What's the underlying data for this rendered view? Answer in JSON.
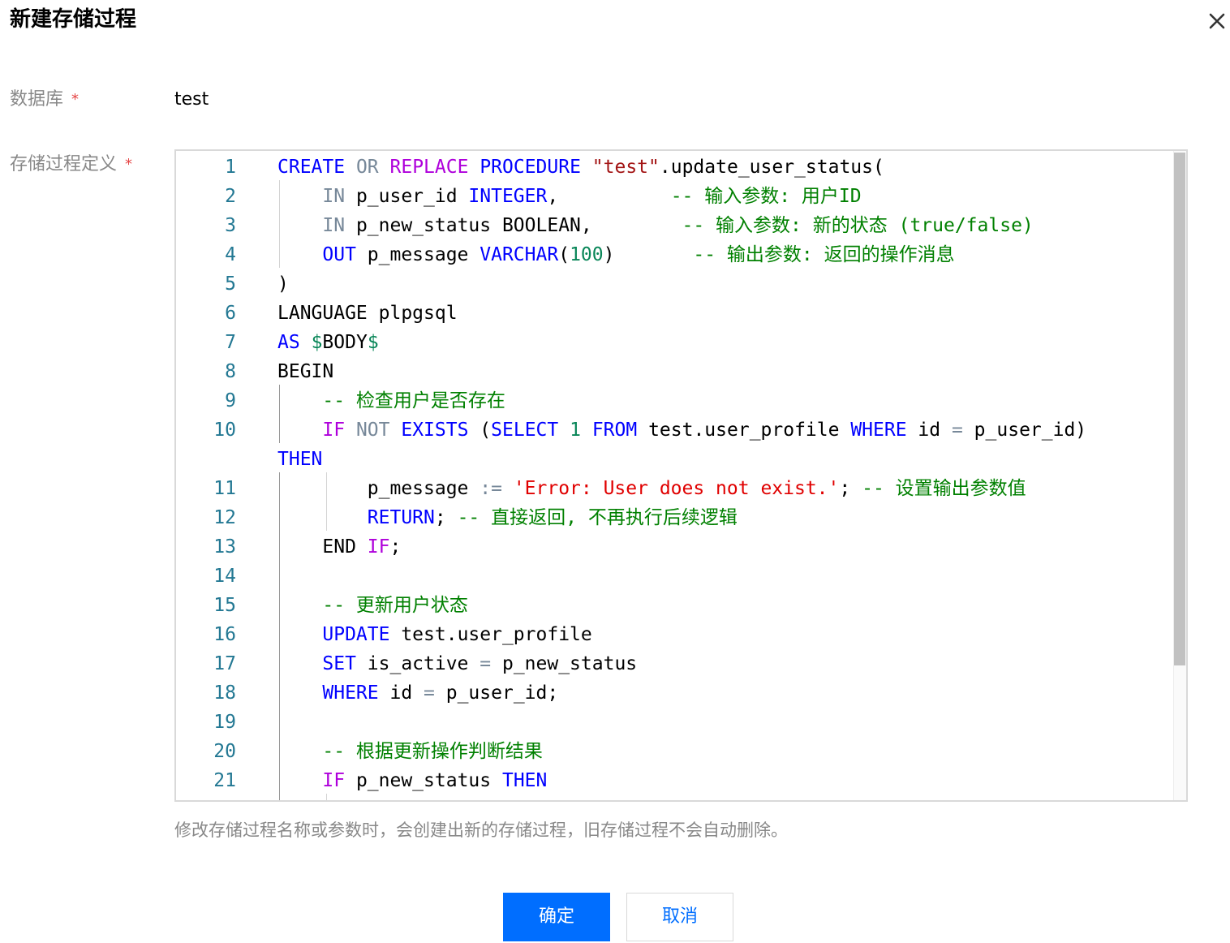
{
  "dialog": {
    "title": "新建存储过程",
    "close_icon": "close-icon"
  },
  "form": {
    "database_label": "数据库",
    "database_value": "test",
    "definition_label": "存储过程定义",
    "required_mark": "*",
    "hint": "修改存储过程名称或参数时，会创建出新的存储过程，旧存储过程不会自动删除。"
  },
  "editor": {
    "lines": [
      {
        "n": "1",
        "tokens": [
          {
            "t": "CREATE",
            "c": "kw"
          },
          {
            "t": " "
          },
          {
            "t": "OR",
            "c": "op"
          },
          {
            "t": " "
          },
          {
            "t": "REPLACE",
            "c": "kw2"
          },
          {
            "t": " "
          },
          {
            "t": "PROCEDURE",
            "c": "kw"
          },
          {
            "t": " "
          },
          {
            "t": "\"test\"",
            "c": "str"
          },
          {
            "t": ".update_user_status("
          }
        ]
      },
      {
        "n": "2",
        "tokens": [
          {
            "t": "    "
          },
          {
            "t": "IN",
            "c": "op"
          },
          {
            "t": " p_user_id "
          },
          {
            "t": "INTEGER",
            "c": "kw"
          },
          {
            "t": ",          "
          },
          {
            "t": "-- 输入参数: 用户ID",
            "c": "cmt"
          }
        ]
      },
      {
        "n": "3",
        "tokens": [
          {
            "t": "    "
          },
          {
            "t": "IN",
            "c": "op"
          },
          {
            "t": " p_new_status BOOLEAN,        "
          },
          {
            "t": "-- 输入参数: 新的状态 (true/false)",
            "c": "cmt"
          }
        ]
      },
      {
        "n": "4",
        "tokens": [
          {
            "t": "    "
          },
          {
            "t": "OUT",
            "c": "kw"
          },
          {
            "t": " p_message "
          },
          {
            "t": "VARCHAR",
            "c": "kw"
          },
          {
            "t": "("
          },
          {
            "t": "100",
            "c": "num"
          },
          {
            "t": ")       "
          },
          {
            "t": "-- 输出参数: 返回的操作消息",
            "c": "cmt"
          }
        ]
      },
      {
        "n": "5",
        "tokens": [
          {
            "t": ")"
          }
        ]
      },
      {
        "n": "6",
        "tokens": [
          {
            "t": "LANGUAGE plpgsql"
          }
        ]
      },
      {
        "n": "7",
        "tokens": [
          {
            "t": "AS",
            "c": "kw"
          },
          {
            "t": " "
          },
          {
            "t": "$",
            "c": "dol"
          },
          {
            "t": "BODY"
          },
          {
            "t": "$",
            "c": "dol"
          }
        ]
      },
      {
        "n": "8",
        "tokens": [
          {
            "t": "BEGIN"
          }
        ]
      },
      {
        "n": "9",
        "tokens": [
          {
            "t": "    "
          },
          {
            "t": "-- 检查用户是否存在",
            "c": "cmt"
          }
        ]
      },
      {
        "n": "10",
        "tokens": [
          {
            "t": "    "
          },
          {
            "t": "IF",
            "c": "kw2"
          },
          {
            "t": " "
          },
          {
            "t": "NOT",
            "c": "op"
          },
          {
            "t": " "
          },
          {
            "t": "EXISTS",
            "c": "kw"
          },
          {
            "t": " ("
          },
          {
            "t": "SELECT",
            "c": "kw"
          },
          {
            "t": " "
          },
          {
            "t": "1",
            "c": "num"
          },
          {
            "t": " "
          },
          {
            "t": "FROM",
            "c": "kw"
          },
          {
            "t": " test.user_profile "
          },
          {
            "t": "WHERE",
            "c": "kw"
          },
          {
            "t": " id "
          },
          {
            "t": "=",
            "c": "op"
          },
          {
            "t": " p_user_id)"
          }
        ]
      },
      {
        "n": "",
        "tokens": [
          {
            "t": "THEN",
            "c": "kw"
          }
        ]
      },
      {
        "n": "11",
        "tokens": [
          {
            "t": "        p_message "
          },
          {
            "t": ":=",
            "c": "op"
          },
          {
            "t": " "
          },
          {
            "t": "'Error: User does not exist.'",
            "c": "err"
          },
          {
            "t": "; "
          },
          {
            "t": "-- 设置输出参数值",
            "c": "cmt"
          }
        ]
      },
      {
        "n": "12",
        "tokens": [
          {
            "t": "        "
          },
          {
            "t": "RETURN",
            "c": "kw"
          },
          {
            "t": "; "
          },
          {
            "t": "-- 直接返回, 不再执行后续逻辑",
            "c": "cmt"
          }
        ]
      },
      {
        "n": "13",
        "tokens": [
          {
            "t": "    END "
          },
          {
            "t": "IF",
            "c": "kw2"
          },
          {
            "t": ";"
          }
        ]
      },
      {
        "n": "14",
        "tokens": []
      },
      {
        "n": "15",
        "tokens": [
          {
            "t": "    "
          },
          {
            "t": "-- 更新用户状态",
            "c": "cmt"
          }
        ]
      },
      {
        "n": "16",
        "tokens": [
          {
            "t": "    "
          },
          {
            "t": "UPDATE",
            "c": "kw"
          },
          {
            "t": " test.user_profile"
          }
        ]
      },
      {
        "n": "17",
        "tokens": [
          {
            "t": "    "
          },
          {
            "t": "SET",
            "c": "kw"
          },
          {
            "t": " is_active "
          },
          {
            "t": "=",
            "c": "op"
          },
          {
            "t": " p_new_status"
          }
        ]
      },
      {
        "n": "18",
        "tokens": [
          {
            "t": "    "
          },
          {
            "t": "WHERE",
            "c": "kw"
          },
          {
            "t": " id "
          },
          {
            "t": "=",
            "c": "op"
          },
          {
            "t": " p_user_id;"
          }
        ]
      },
      {
        "n": "19",
        "tokens": []
      },
      {
        "n": "20",
        "tokens": [
          {
            "t": "    "
          },
          {
            "t": "-- 根据更新操作判断结果",
            "c": "cmt"
          }
        ]
      },
      {
        "n": "21",
        "tokens": [
          {
            "t": "    "
          },
          {
            "t": "IF",
            "c": "kw2"
          },
          {
            "t": " p_new_status "
          },
          {
            "t": "THEN",
            "c": "kw"
          }
        ]
      }
    ]
  },
  "buttons": {
    "confirm": "确定",
    "cancel": "取消"
  },
  "colors": {
    "primary": "#006eff",
    "required": "#e54545",
    "keyword": "#0000ff",
    "control": "#af00db",
    "comment": "#008000",
    "string": "#a31515",
    "error_string": "#e00000",
    "line_number": "#237893"
  }
}
